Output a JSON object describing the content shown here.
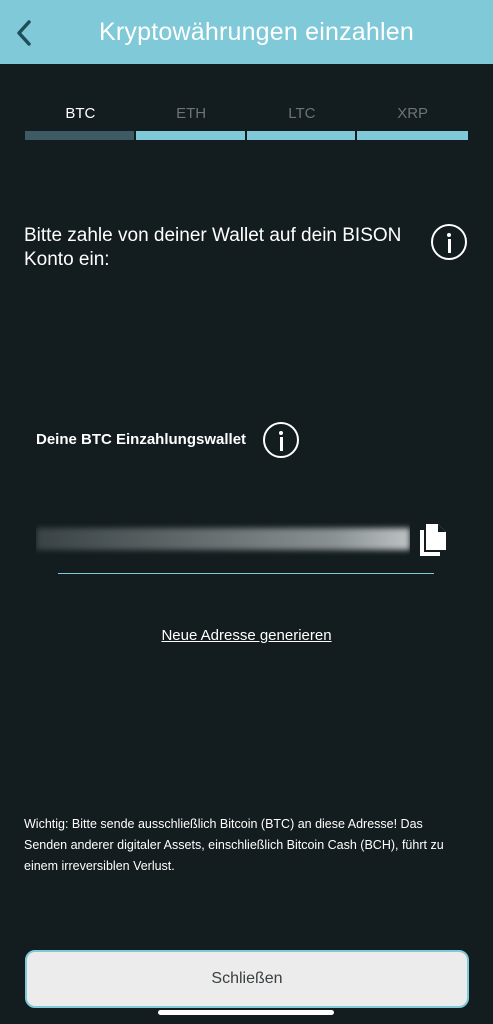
{
  "header": {
    "title": "Kryptowährungen einzahlen",
    "back_icon": "chevron-left-icon",
    "color": "#80c9d8"
  },
  "tabs": [
    {
      "label": "BTC",
      "active": true
    },
    {
      "label": "ETH",
      "active": false
    },
    {
      "label": "LTC",
      "active": false
    },
    {
      "label": "XRP",
      "active": false
    }
  ],
  "instruction": "Bitte zahle von deiner Wallet auf dein BISON Konto ein:",
  "wallet": {
    "label": "Deine BTC Einzahlungswallet",
    "copy_icon": "copy-icon",
    "info_icon": "info-icon"
  },
  "new_address_label": "Neue Adresse generieren",
  "warning": "Wichtig: Bitte sende ausschließlich Bitcoin (BTC) an diese Adresse! Das Senden anderer digitaler Assets, einschließlich Bitcoin Cash (BCH), führt zu einem irreversiblen Verlust.",
  "close_button_label": "Schließen",
  "colors": {
    "background": "#131c1e",
    "accent": "#80c9d8",
    "active_tab_bar": "#3e5a62"
  }
}
